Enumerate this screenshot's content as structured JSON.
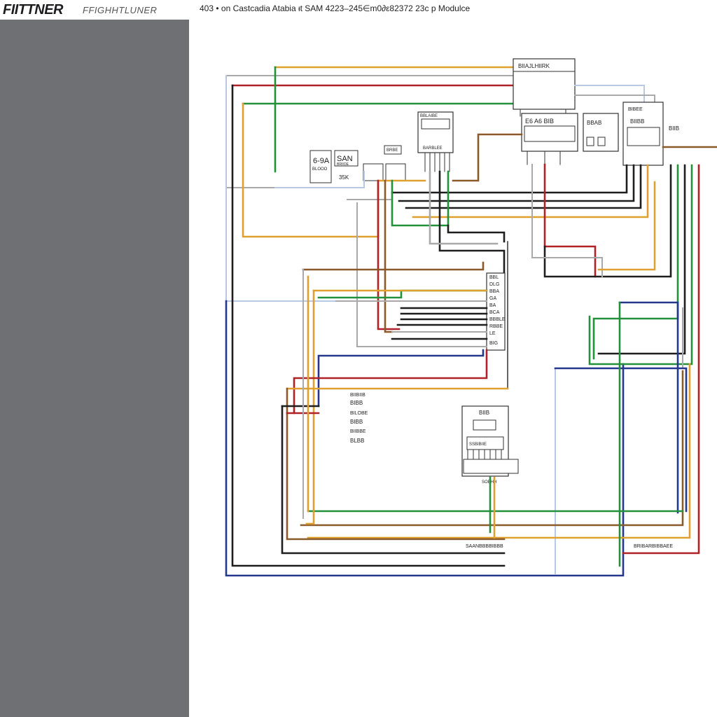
{
  "header": {
    "brand_primary": "FIITTNER",
    "brand_secondary": "FFIGHHTLUNER",
    "title": "403 • on Castcadia Atabia ᵻt SAM 4223–245∈m0∂ε82372 23c p Modulce"
  },
  "diagram": {
    "wire_colors": {
      "orange": "#e0a030",
      "red": "#b02228",
      "green": "#23913b",
      "blue": "#26388e",
      "black": "#1e1e1e",
      "brown": "#8a5a2b",
      "gray": "#a9a9a9",
      "lightblue": "#b9c8e3"
    },
    "components": {
      "top_module_label": "BIIAJLHIIRK",
      "left_block_a_label": "6-9A",
      "left_block_a_sub": "BLOOO",
      "left_block_b_label": "SAN",
      "left_block_b_sub": "BRIIOE",
      "left_block_b_note": "35K",
      "small_connector_label": "BRBE",
      "center_connector_label": "BBLAIBE",
      "center_connector_sub": "BARBLEE",
      "mid_connector_label": "E6 A6 BIB",
      "mid_right_label": "BBAB",
      "right_connector_label": "BIBEE",
      "right_connector_sub": "BIIBB",
      "far_right_label": "BIIB",
      "bottom_module_label": "BIIB",
      "bottom_module_sub": "SSBIBIIE",
      "bottom_module_pin_note": "SOEHH",
      "bottom_left_footer": "SAANBBBBIBBB",
      "bottom_right_footer": "BRIBARBIBBAEE",
      "terminal_block_labels": [
        "BBL",
        "DLG",
        "BBA",
        "GA",
        "BA",
        "BCA",
        "BBBLE",
        "RBBE",
        "LE",
        "BIG"
      ],
      "left_legend_lines": [
        "BIIBIIB",
        "BIBB",
        "BILOBE",
        "BIBB",
        "BIIBBE",
        "BLBB"
      ]
    }
  }
}
